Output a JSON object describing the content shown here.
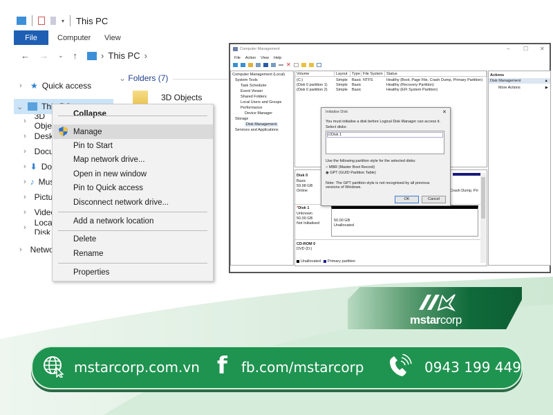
{
  "explorer": {
    "title": "This PC",
    "ribbon_tabs": [
      "File",
      "Computer",
      "View"
    ],
    "address": {
      "breadcrumb": "This PC"
    },
    "nav": {
      "quick_access": "Quick access",
      "this_pc": "This PC",
      "children": [
        "3D Objects",
        "Desktop",
        "Documents",
        "Downloads",
        "Music",
        "Pictures",
        "Videos",
        "Local Disk"
      ],
      "network": "Network"
    },
    "content": {
      "section": "Folders (7)",
      "first_item": "3D Objects"
    }
  },
  "context_menu": {
    "items": [
      "Collapse",
      "Manage",
      "Pin to Start",
      "Map network drive...",
      "Open in new window",
      "Pin to Quick access",
      "Disconnect network drive...",
      "Add a network location",
      "Delete",
      "Rename",
      "Properties"
    ],
    "highlighted": "Manage"
  },
  "computer_management": {
    "title": "Computer Management",
    "menu": [
      "File",
      "Action",
      "View",
      "Help"
    ],
    "tree": [
      "Computer Management (Local)",
      "System Tools",
      "Task Scheduler",
      "Event Viewer",
      "Shared Folders",
      "Local Users and Groups",
      "Performance",
      "Device Manager",
      "Storage",
      "Disk Management",
      "Services and Applications"
    ],
    "volume_headers": [
      "Volume",
      "Layout",
      "Type",
      "File System",
      "Status"
    ],
    "volumes": [
      [
        "(C:)",
        "Simple",
        "Basic",
        "NTFS",
        "Healthy (Boot, Page File, Crash Dump, Primary Partition)"
      ],
      [
        "(Disk 0 partition 1)",
        "Simple",
        "Basic",
        "",
        "Healthy (Recovery Partition)"
      ],
      [
        "(Disk 0 partition 2)",
        "Simple",
        "Basic",
        "",
        "Healthy (EFI System Partition)"
      ]
    ],
    "disks": [
      {
        "name": "Disk 0",
        "type": "Basic",
        "size": "59.98 GB",
        "state": "Online",
        "partition_text": "Crash Dump, Pri"
      },
      {
        "name": "Disk 1",
        "type": "Unknown",
        "size": "50.00 GB",
        "state": "Not Initialised",
        "partition_size": "50.00 GB",
        "partition_state": "Unallocated"
      },
      {
        "name": "CD-ROM 0",
        "type": "DVD (D:)"
      }
    ],
    "legend": [
      "Unallocated",
      "Primary partition"
    ],
    "actions": {
      "header": "Actions",
      "section": "Disk Management",
      "more": "More Actions"
    },
    "dialog": {
      "title": "Initialise Disk",
      "message": "You must initialise a disk before Logical Disk Manager can access it.",
      "select_label": "Select disks:",
      "disk_item": "Disk 1",
      "style_label": "Use the following partition style for the selected disks:",
      "options": [
        "MBR (Master Boot Record)",
        "GPT (GUID Partition Table)"
      ],
      "selected_option": "GPT (GUID Partition Table)",
      "note": "Note: The GPT partition style is not recognised by all previous versions of Windows.",
      "ok": "OK",
      "cancel": "Cancel"
    }
  },
  "brand": {
    "name_bold": "mstar",
    "name_light": "corp",
    "color": "#1f9350"
  },
  "contact": {
    "website": "mstarcorp.com.vn",
    "facebook": "fb.com/mstarcorp",
    "phone": "0943 199 449"
  }
}
